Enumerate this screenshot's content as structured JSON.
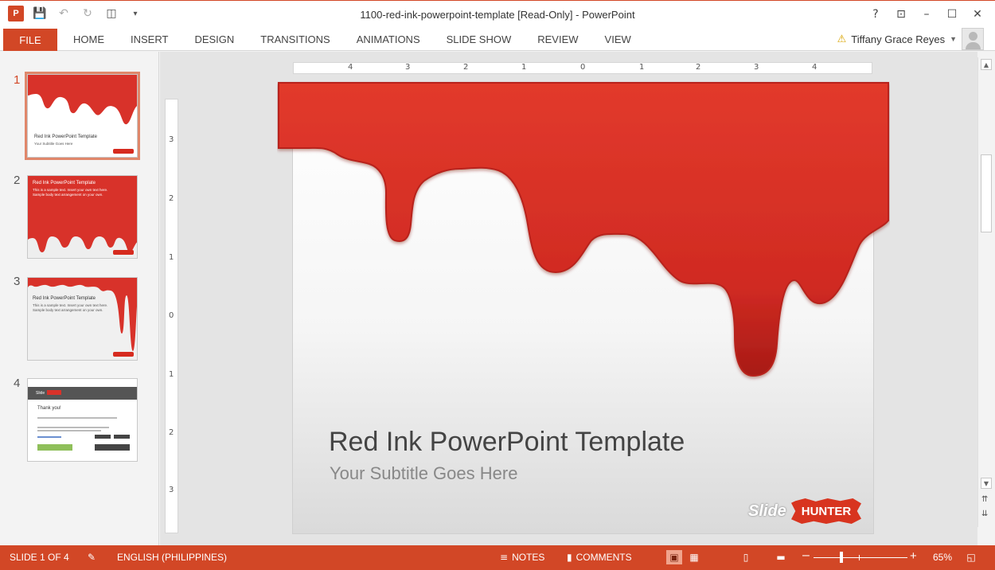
{
  "window": {
    "title": "1100-red-ink-powerpoint-template [Read-Only] - PowerPoint",
    "app_logo": "P",
    "qat": {
      "save_icon": "save-icon",
      "undo_icon": "undo-icon",
      "redo_icon": "redo-icon",
      "present_icon": "start-from-beginning-icon",
      "customize_icon": "customize-qat-icon"
    },
    "controls": {
      "help": "?",
      "ribbon_options": "⊡",
      "minimize": "–",
      "maximize": "☐",
      "close": "✕"
    }
  },
  "ribbon": {
    "file_tab": "FILE",
    "tabs": [
      "HOME",
      "INSERT",
      "DESIGN",
      "TRANSITIONS",
      "ANIMATIONS",
      "SLIDE SHOW",
      "REVIEW",
      "VIEW"
    ],
    "user_name": "Tiffany Grace Reyes"
  },
  "thumbnails": {
    "numbers": [
      "1",
      "2",
      "3",
      "4"
    ],
    "slide1": {
      "title": "Red Ink PowerPoint Template",
      "subtitle": "Your Subtitle Goes Here"
    },
    "slide2": {
      "title": "Red Ink PowerPoint Template",
      "line1": "This is a sample text. Insert your own text here.",
      "line2": "Sample body text arrangement on your own."
    },
    "slide3": {
      "title": "Red Ink PowerPoint Template",
      "line1": "This is a sample text. Insert your own text here.",
      "line2": "Sample body text arrangement on your own."
    },
    "slide4": {
      "title": "Thank you!",
      "brand": "Slide"
    }
  },
  "rulers": {
    "horizontal": [
      "4",
      "3",
      "2",
      "1",
      "0",
      "1",
      "2",
      "3",
      "4"
    ],
    "vertical": [
      "3",
      "2",
      "1",
      "0",
      "1",
      "2",
      "3"
    ]
  },
  "slide": {
    "title": "Red Ink PowerPoint Template",
    "subtitle": "Your Subtitle Goes Here",
    "brand_slide": "Slide",
    "brand_hunter": "HUNTER",
    "ink_color": "#d8322a"
  },
  "statusbar": {
    "slide_counter": "SLIDE 1 OF 4",
    "language": "ENGLISH (PHILIPPINES)",
    "notes": "NOTES",
    "comments": "COMMENTS",
    "zoom": "65%",
    "zoom_level": 0.65
  },
  "colors": {
    "accent": "#d24726"
  }
}
